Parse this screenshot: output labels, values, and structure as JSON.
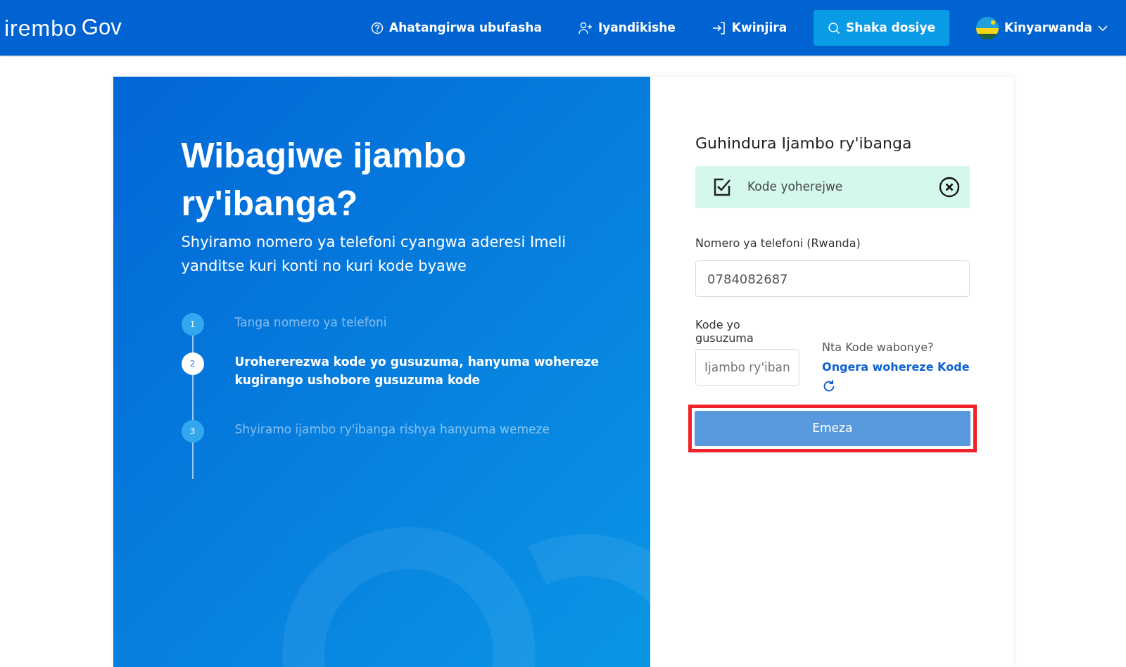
{
  "navbar": {
    "logo": "irembo",
    "logo_suffix": "Gov",
    "items": [
      {
        "kind": "help",
        "label": "Ahatangirwa ubufasha"
      },
      {
        "kind": "register",
        "label": "Iyandikishe"
      },
      {
        "kind": "login",
        "label": "Kwinjira"
      },
      {
        "kind": "search",
        "label": "Shaka dosiye"
      }
    ],
    "language": "Kinyarwanda"
  },
  "intro": {
    "title": "Wibagiwe ijambo ry'ibanga?",
    "subtitle": "Shyiramo nomero ya telefoni cyangwa aderesi Imeli yanditse kuri konti no kuri kode byawe",
    "steps": [
      {
        "number": "1",
        "text": "Tanga nomero ya telefoni",
        "selected": false
      },
      {
        "number": "2",
        "text": "Urohererezwa kode yo gusuzuma, hanyuma wohereze kugirango ushobore gusuzuma kode",
        "selected": true
      },
      {
        "number": "3",
        "text": "Shyiramo ijambo ry'ibanga rishya hanyuma wemeze",
        "selected": false
      }
    ]
  },
  "form": {
    "title": "Guhindura Ijambo ry'ibanga",
    "alert": {
      "text": "Kode yoherejwe"
    },
    "phone": {
      "label": "Nomero ya telefoni (Rwanda)",
      "value": "0784082687"
    },
    "code": {
      "label": "Kode yo gusuzuma",
      "placeholder": "Ijambo ry'iban"
    },
    "resend": {
      "question": "Nta Kode wabonye?",
      "link": "Ongera wohereze Kode"
    },
    "submit": {
      "label": "Emeza",
      "highlighted": true
    }
  }
}
